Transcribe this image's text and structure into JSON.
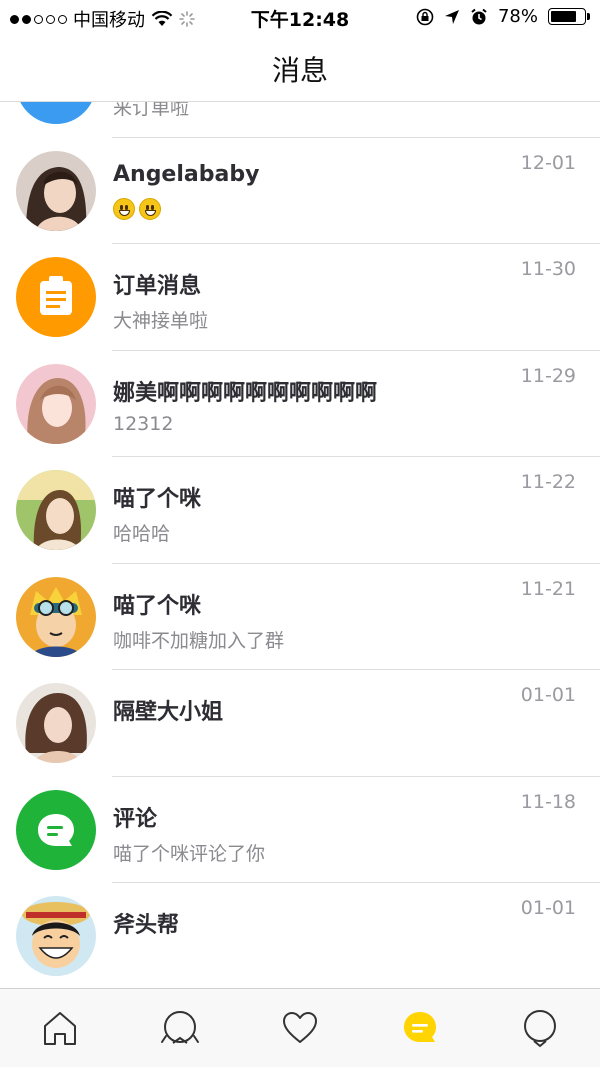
{
  "status_bar": {
    "carrier": "中国移动",
    "time": "下午12:48",
    "battery_percent": "78%",
    "battery_level": 0.78,
    "signal_dots_filled": 2,
    "signal_dots_total": 5
  },
  "nav": {
    "title": "消息"
  },
  "messages": [
    {
      "name": "",
      "preview": "来订单啦",
      "date": "",
      "avatar": "blue-circle"
    },
    {
      "name": "Angelababy",
      "preview": "😃😃",
      "date": "12-01",
      "avatar": "photo-woman"
    },
    {
      "name": "订单消息",
      "preview": "大神接单啦",
      "date": "11-30",
      "avatar": "clipboard-icon"
    },
    {
      "name": "娜美啊啊啊啊啊啊啊啊啊啊",
      "preview": "12312",
      "date": "11-29",
      "avatar": "photo-woman-pink"
    },
    {
      "name": "喵了个咪",
      "preview": "哈哈哈",
      "date": "11-22",
      "avatar": "photo-woman-outdoor"
    },
    {
      "name": "喵了个咪",
      "preview": "咖啡不加糖加入了群",
      "date": "11-21",
      "avatar": "cartoon-goggles"
    },
    {
      "name": "隔壁大小姐",
      "preview": "",
      "date": "01-01",
      "avatar": "photo-woman-brown"
    },
    {
      "name": "评论",
      "preview": "喵了个咪评论了你",
      "date": "11-18",
      "avatar": "comment-icon"
    },
    {
      "name": "斧头帮",
      "preview": "",
      "date": "01-01",
      "avatar": "cartoon-straw-hat"
    }
  ],
  "tab_bar": {
    "tabs": [
      {
        "icon": "home-icon",
        "active": false
      },
      {
        "icon": "discover-icon",
        "active": false
      },
      {
        "icon": "heart-icon",
        "active": false
      },
      {
        "icon": "message-icon",
        "active": true
      },
      {
        "icon": "profile-icon",
        "active": false
      }
    ]
  },
  "colors": {
    "accent": "#ffd400",
    "order_orange": "#ff9a00",
    "comment_green": "#1fb33a",
    "top_blue": "#3a9bf0"
  }
}
